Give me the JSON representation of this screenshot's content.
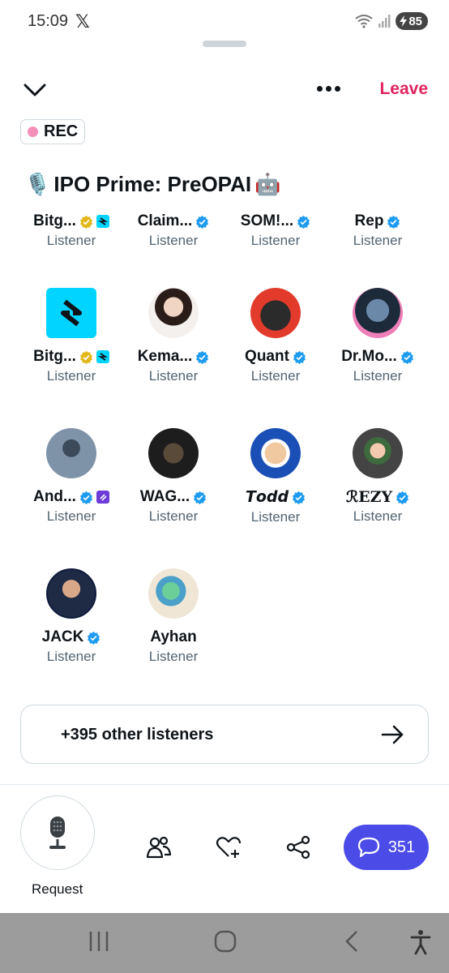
{
  "status_bar": {
    "time": "15:09",
    "x_logo": "𝕏",
    "battery": "85"
  },
  "header": {
    "leave_label": "Leave"
  },
  "rec_badge": {
    "label": "REC"
  },
  "space": {
    "title": "IPO Prime: PreOPAI",
    "title_prefix_emoji": "🎙️",
    "title_suffix_emoji": "🤖"
  },
  "participants": [
    {
      "name": "Bitg...",
      "role": "Listener",
      "verified": "gold",
      "org": "bitget"
    },
    {
      "name": "Claim...",
      "role": "Listener",
      "verified": "blue"
    },
    {
      "name": "SOM!...",
      "role": "Listener",
      "verified": "blue"
    },
    {
      "name": "Rep",
      "role": "Listener",
      "verified": "blue"
    },
    {
      "name": "Bitg...",
      "role": "Listener",
      "verified": "gold",
      "org": "bitget"
    },
    {
      "name": "Kema...",
      "role": "Listener",
      "verified": "blue"
    },
    {
      "name": "Quant",
      "role": "Listener",
      "verified": "blue"
    },
    {
      "name": "Dr.Mo...",
      "role": "Listener",
      "verified": "blue"
    },
    {
      "name": "And...",
      "role": "Listener",
      "verified": "blue",
      "org": "purple"
    },
    {
      "name": "WAG...",
      "role": "Listener",
      "verified": "blue"
    },
    {
      "name": "𝙏𝙤𝙙𝙙",
      "role": "Listener",
      "verified": "blue"
    },
    {
      "name": "ℛEZY",
      "role": "Listener",
      "verified": "blue"
    },
    {
      "name": "JACK",
      "role": "Listener",
      "verified": "blue"
    },
    {
      "name": "Ayhan",
      "role": "Listener",
      "verified": "none"
    }
  ],
  "other_listeners": {
    "label": "+395 other listeners"
  },
  "bottom_bar": {
    "request_label": "Request",
    "reply_count": "351"
  },
  "colors": {
    "accent": "#e0245e",
    "reply_button": "#4b4ce8",
    "verified_blue": "#1d9bf0",
    "verified_gold": "#e2b719",
    "bitget_cyan": "#00d4ff"
  },
  "icons": [
    "chevron-down-icon",
    "more-icon",
    "microphone-icon",
    "people-icon",
    "heart-plus-icon",
    "share-icon",
    "reply-bubble-icon",
    "arrow-right-icon"
  ]
}
